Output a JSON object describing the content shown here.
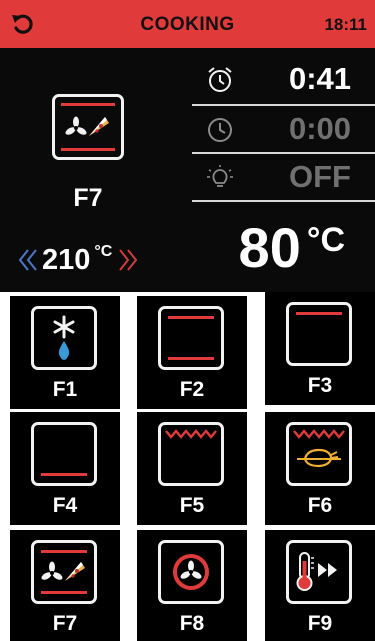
{
  "status_bar": {
    "title": "COOKING",
    "time": "18:11",
    "back_icon": "refresh-back-icon",
    "color": "#e13a3a"
  },
  "program": {
    "label": "F7",
    "icon": "fan-pizza-icon"
  },
  "set_temperature": {
    "value": "210",
    "unit": "°C"
  },
  "timers": [
    {
      "icon": "alarm-clock-icon",
      "value": "0:41"
    },
    {
      "icon": "clock-icon",
      "value": "0:00"
    },
    {
      "icon": "light-bulb-icon",
      "value": "OFF"
    }
  ],
  "current_temperature": {
    "value": "80",
    "unit": "°C"
  },
  "functions": [
    {
      "label": "F1",
      "icon": "defrost-icon"
    },
    {
      "label": "F2",
      "icon": "top-bottom-heat-icon"
    },
    {
      "label": "F3",
      "icon": "top-heat-icon"
    },
    {
      "label": "F4",
      "icon": "bottom-heat-icon"
    },
    {
      "label": "F5",
      "icon": "grill-icon"
    },
    {
      "label": "F6",
      "icon": "rotisserie-grill-icon"
    },
    {
      "label": "F7",
      "icon": "fan-pizza-icon"
    },
    {
      "label": "F8",
      "icon": "fan-icon"
    },
    {
      "label": "F9",
      "icon": "rapid-preheat-icon"
    }
  ]
}
